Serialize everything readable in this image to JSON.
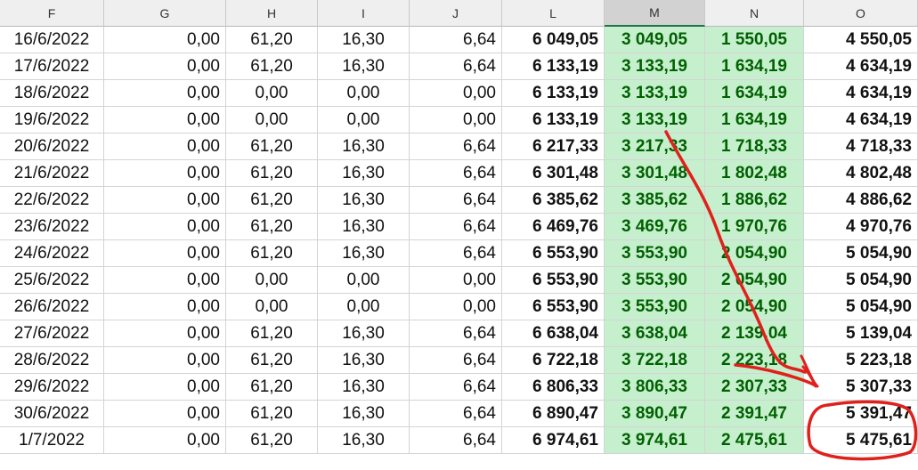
{
  "columns": [
    "F",
    "G",
    "H",
    "I",
    "J",
    "L",
    "M",
    "N",
    "O"
  ],
  "selected_column": "M",
  "rows": [
    {
      "F": "16/6/2022",
      "G": "0,00",
      "H": "61,20",
      "I": "16,30",
      "J": "6,64",
      "L": "6 049,05",
      "M": "3 049,05",
      "N": "1 550,05",
      "O": "4 550,05"
    },
    {
      "F": "17/6/2022",
      "G": "0,00",
      "H": "61,20",
      "I": "16,30",
      "J": "6,64",
      "L": "6 133,19",
      "M": "3 133,19",
      "N": "1 634,19",
      "O": "4 634,19"
    },
    {
      "F": "18/6/2022",
      "G": "0,00",
      "H": "0,00",
      "I": "0,00",
      "J": "0,00",
      "L": "6 133,19",
      "M": "3 133,19",
      "N": "1 634,19",
      "O": "4 634,19"
    },
    {
      "F": "19/6/2022",
      "G": "0,00",
      "H": "0,00",
      "I": "0,00",
      "J": "0,00",
      "L": "6 133,19",
      "M": "3 133,19",
      "N": "1 634,19",
      "O": "4 634,19"
    },
    {
      "F": "20/6/2022",
      "G": "0,00",
      "H": "61,20",
      "I": "16,30",
      "J": "6,64",
      "L": "6 217,33",
      "M": "3 217,33",
      "N": "1 718,33",
      "O": "4 718,33"
    },
    {
      "F": "21/6/2022",
      "G": "0,00",
      "H": "61,20",
      "I": "16,30",
      "J": "6,64",
      "L": "6 301,48",
      "M": "3 301,48",
      "N": "1 802,48",
      "O": "4 802,48"
    },
    {
      "F": "22/6/2022",
      "G": "0,00",
      "H": "61,20",
      "I": "16,30",
      "J": "6,64",
      "L": "6 385,62",
      "M": "3 385,62",
      "N": "1 886,62",
      "O": "4 886,62"
    },
    {
      "F": "23/6/2022",
      "G": "0,00",
      "H": "61,20",
      "I": "16,30",
      "J": "6,64",
      "L": "6 469,76",
      "M": "3 469,76",
      "N": "1 970,76",
      "O": "4 970,76"
    },
    {
      "F": "24/6/2022",
      "G": "0,00",
      "H": "61,20",
      "I": "16,30",
      "J": "6,64",
      "L": "6 553,90",
      "M": "3 553,90",
      "N": "2 054,90",
      "O": "5 054,90"
    },
    {
      "F": "25/6/2022",
      "G": "0,00",
      "H": "0,00",
      "I": "0,00",
      "J": "0,00",
      "L": "6 553,90",
      "M": "3 553,90",
      "N": "2 054,90",
      "O": "5 054,90"
    },
    {
      "F": "26/6/2022",
      "G": "0,00",
      "H": "0,00",
      "I": "0,00",
      "J": "0,00",
      "L": "6 553,90",
      "M": "3 553,90",
      "N": "2 054,90",
      "O": "5 054,90"
    },
    {
      "F": "27/6/2022",
      "G": "0,00",
      "H": "61,20",
      "I": "16,30",
      "J": "6,64",
      "L": "6 638,04",
      "M": "3 638,04",
      "N": "2 139,04",
      "O": "5 139,04"
    },
    {
      "F": "28/6/2022",
      "G": "0,00",
      "H": "61,20",
      "I": "16,30",
      "J": "6,64",
      "L": "6 722,18",
      "M": "3 722,18",
      "N": "2 223,18",
      "O": "5 223,18"
    },
    {
      "F": "29/6/2022",
      "G": "0,00",
      "H": "61,20",
      "I": "16,30",
      "J": "6,64",
      "L": "6 806,33",
      "M": "3 806,33",
      "N": "2 307,33",
      "O": "5 307,33"
    },
    {
      "F": "30/6/2022",
      "G": "0,00",
      "H": "61,20",
      "I": "16,30",
      "J": "6,64",
      "L": "6 890,47",
      "M": "3 890,47",
      "N": "2 391,47",
      "O": "5 391,47"
    },
    {
      "F": "1/7/2022",
      "G": "0,00",
      "H": "61,20",
      "I": "16,30",
      "J": "6,64",
      "L": "6 974,61",
      "M": "3 974,61",
      "N": "2 475,61",
      "O": "5 475,61"
    }
  ],
  "colors": {
    "highlight_fill": "#c6efce",
    "highlight_text": "#006100",
    "annotation": "#e0201b"
  }
}
